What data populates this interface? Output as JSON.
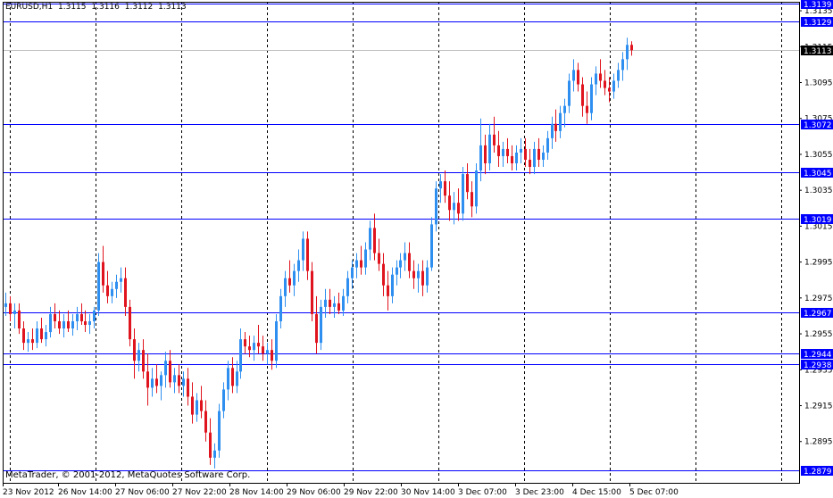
{
  "header": {
    "symbol": "EURUSD,H1",
    "open": "1.3115",
    "high": "1.3116",
    "low": "1.3112",
    "close": "1.3113"
  },
  "footer": {
    "copyright": "MetaTrader, © 2001-2012, MetaQuotes Software Corp."
  },
  "colors": {
    "background": "#ffffff",
    "frame": "#000000",
    "grid": "#000000",
    "bull": "#2e8ff0",
    "bear": "#e0141e",
    "level_line": "#0000ff",
    "level_label_bg": "#0000ff",
    "level_label_text": "#ffffff",
    "bid_line": "#c0c0c0",
    "bid_label_bg": "#000000",
    "bid_label_text": "#ffffff"
  },
  "chart_data": {
    "type": "candlestick",
    "timeframe": "H1",
    "ylim": [
      1.2872,
      1.314
    ],
    "y_ticks": [
      "1.3135",
      "1.3115",
      "1.3095",
      "1.3075",
      "1.3055",
      "1.3035",
      "1.3015",
      "1.2995",
      "1.2975",
      "1.2955",
      "1.2935",
      "1.2915",
      "1.2895"
    ],
    "x_ticks": [
      "23 Nov 2012",
      "26 Nov 14:00",
      "27 Nov 06:00",
      "27 Nov 22:00",
      "28 Nov 14:00",
      "29 Nov 06:00",
      "29 Nov 22:00",
      "30 Nov 14:00",
      "3 Dec 07:00",
      "3 Dec 23:00",
      "4 Dec 15:00",
      "5 Dec 07:00"
    ],
    "horizontal_levels": [
      "1.3139",
      "1.3129",
      "1.3072",
      "1.3045",
      "1.3019",
      "1.2967",
      "1.2944",
      "1.2938",
      "1.2879"
    ],
    "bid": "1.3113",
    "grid": "vertical dashed",
    "candles": [
      [
        1.297,
        1.2978,
        1.2965,
        1.2972
      ],
      [
        1.2972,
        1.2976,
        1.2962,
        1.2966
      ],
      [
        1.2966,
        1.2972,
        1.2958,
        1.2968
      ],
      [
        1.2968,
        1.2972,
        1.2955,
        1.2958
      ],
      [
        1.2958,
        1.2962,
        1.2946,
        1.295
      ],
      [
        1.295,
        1.2956,
        1.2945,
        1.2952
      ],
      [
        1.2952,
        1.2958,
        1.2946,
        1.295
      ],
      [
        1.295,
        1.2962,
        1.2947,
        1.2958
      ],
      [
        1.2958,
        1.2964,
        1.295,
        1.2952
      ],
      [
        1.2952,
        1.296,
        1.2948,
        1.2956
      ],
      [
        1.2956,
        1.297,
        1.2953,
        1.2966
      ],
      [
        1.2966,
        1.2972,
        1.2958,
        1.2962
      ],
      [
        1.2962,
        1.2968,
        1.2955,
        1.2958
      ],
      [
        1.2958,
        1.2966,
        1.2953,
        1.2962
      ],
      [
        1.2962,
        1.2968,
        1.2956,
        1.2958
      ],
      [
        1.2958,
        1.2966,
        1.2954,
        1.2962
      ],
      [
        1.2962,
        1.297,
        1.2957,
        1.2966
      ],
      [
        1.2966,
        1.2972,
        1.296,
        1.2962
      ],
      [
        1.2962,
        1.2968,
        1.2956,
        1.296
      ],
      [
        1.296,
        1.2966,
        1.2955,
        1.2962
      ],
      [
        1.2962,
        1.297,
        1.2958,
        1.2968
      ],
      [
        1.2968,
        1.3,
        1.2965,
        1.2995
      ],
      [
        1.2995,
        1.3004,
        1.2978,
        1.2982
      ],
      [
        1.2982,
        1.299,
        1.2972,
        1.2976
      ],
      [
        1.2976,
        1.2984,
        1.2972,
        1.298
      ],
      [
        1.298,
        1.2988,
        1.2975,
        1.2984
      ],
      [
        1.2984,
        1.2992,
        1.2978,
        1.2986
      ],
      [
        1.2986,
        1.2992,
        1.2965,
        1.297
      ],
      [
        1.297,
        1.2974,
        1.2948,
        1.2952
      ],
      [
        1.2952,
        1.2958,
        1.293,
        1.294
      ],
      [
        1.294,
        1.295,
        1.2934,
        1.2946
      ],
      [
        1.2946,
        1.2952,
        1.293,
        1.2934
      ],
      [
        1.2934,
        1.2944,
        1.2915,
        1.2925
      ],
      [
        1.2925,
        1.2936,
        1.292,
        1.293
      ],
      [
        1.293,
        1.2938,
        1.2922,
        1.2926
      ],
      [
        1.2926,
        1.2934,
        1.2918,
        1.2932
      ],
      [
        1.2932,
        1.2945,
        1.2925,
        1.294
      ],
      [
        1.294,
        1.2946,
        1.2925,
        1.2928
      ],
      [
        1.2928,
        1.2936,
        1.2922,
        1.2932
      ],
      [
        1.2932,
        1.2938,
        1.2922,
        1.2926
      ],
      [
        1.2926,
        1.2934,
        1.292,
        1.293
      ],
      [
        1.293,
        1.2936,
        1.2915,
        1.292
      ],
      [
        1.292,
        1.2928,
        1.2905,
        1.291
      ],
      [
        1.291,
        1.2922,
        1.2906,
        1.2918
      ],
      [
        1.2918,
        1.2926,
        1.2908,
        1.2912
      ],
      [
        1.2912,
        1.2918,
        1.2895,
        1.29
      ],
      [
        1.29,
        1.2908,
        1.2882,
        1.2886
      ],
      [
        1.2886,
        1.2894,
        1.288,
        1.289
      ],
      [
        1.289,
        1.2916,
        1.2886,
        1.2912
      ],
      [
        1.2912,
        1.2928,
        1.2908,
        1.2924
      ],
      [
        1.2924,
        1.294,
        1.2918,
        1.2936
      ],
      [
        1.2936,
        1.2942,
        1.2922,
        1.2926
      ],
      [
        1.2926,
        1.294,
        1.2922,
        1.2934
      ],
      [
        1.2934,
        1.2958,
        1.293,
        1.2952
      ],
      [
        1.2952,
        1.2956,
        1.2944,
        1.2948
      ],
      [
        1.2948,
        1.2954,
        1.2942,
        1.2946
      ],
      [
        1.2946,
        1.2954,
        1.294,
        1.295
      ],
      [
        1.295,
        1.296,
        1.2944,
        1.2948
      ],
      [
        1.2948,
        1.2954,
        1.294,
        1.2944
      ],
      [
        1.2944,
        1.295,
        1.2938,
        1.2946
      ],
      [
        1.2946,
        1.2952,
        1.2935,
        1.294
      ],
      [
        1.294,
        1.2966,
        1.2936,
        1.2962
      ],
      [
        1.2962,
        1.298,
        1.2958,
        1.2976
      ],
      [
        1.2976,
        1.299,
        1.297,
        1.2986
      ],
      [
        1.2986,
        1.2996,
        1.2978,
        1.2982
      ],
      [
        1.2982,
        1.2994,
        1.2976,
        1.299
      ],
      [
        1.299,
        1.3002,
        1.2984,
        1.2996
      ],
      [
        1.2996,
        1.3012,
        1.299,
        1.3008
      ],
      [
        1.3008,
        1.3012,
        1.2985,
        1.299
      ],
      [
        1.299,
        1.2995,
        1.2962,
        1.2966
      ],
      [
        1.2966,
        1.2976,
        1.2944,
        1.295
      ],
      [
        1.295,
        1.2974,
        1.2946,
        1.297
      ],
      [
        1.297,
        1.298,
        1.2964,
        1.2974
      ],
      [
        1.2974,
        1.298,
        1.2966,
        1.297
      ],
      [
        1.297,
        1.2976,
        1.2964,
        1.2972
      ],
      [
        1.2972,
        1.2978,
        1.2966,
        1.2968
      ],
      [
        1.2968,
        1.298,
        1.2965,
        1.2976
      ],
      [
        1.2976,
        1.299,
        1.2972,
        1.2986
      ],
      [
        1.2986,
        1.2996,
        1.298,
        1.2992
      ],
      [
        1.2992,
        1.3,
        1.2986,
        1.2996
      ],
      [
        1.2996,
        1.3004,
        1.2988,
        1.2992
      ],
      [
        1.2992,
        1.3006,
        1.2988,
        1.3002
      ],
      [
        1.3002,
        1.3018,
        1.2996,
        1.3014
      ],
      [
        1.3014,
        1.3022,
        1.2996,
        1.3
      ],
      [
        1.3,
        1.3008,
        1.299,
        1.2994
      ],
      [
        1.2994,
        1.3,
        1.2976,
        1.2982
      ],
      [
        1.2982,
        1.299,
        1.2968,
        1.2976
      ],
      [
        1.2976,
        1.2992,
        1.2972,
        1.2988
      ],
      [
        1.2988,
        1.2996,
        1.2982,
        1.2992
      ],
      [
        1.2992,
        1.3,
        1.2986,
        1.2996
      ],
      [
        1.2996,
        1.3006,
        1.299,
        1.3
      ],
      [
        1.3,
        1.3006,
        1.2986,
        1.299
      ],
      [
        1.299,
        1.2996,
        1.298,
        1.2986
      ],
      [
        1.2986,
        1.2994,
        1.2978,
        1.299
      ],
      [
        1.299,
        1.2996,
        1.2976,
        1.2982
      ],
      [
        1.2982,
        1.2996,
        1.2978,
        1.2992
      ],
      [
        1.2992,
        1.302,
        1.299,
        1.3016
      ],
      [
        1.3016,
        1.304,
        1.3012,
        1.3036
      ],
      [
        1.3036,
        1.3044,
        1.3028,
        1.304
      ],
      [
        1.304,
        1.3046,
        1.3028,
        1.3032
      ],
      [
        1.3032,
        1.304,
        1.3018,
        1.3024
      ],
      [
        1.3024,
        1.3034,
        1.3016,
        1.3028
      ],
      [
        1.3028,
        1.3036,
        1.3018,
        1.3022
      ],
      [
        1.3022,
        1.3048,
        1.3018,
        1.3044
      ],
      [
        1.3044,
        1.305,
        1.303,
        1.3034
      ],
      [
        1.3034,
        1.304,
        1.302,
        1.3026
      ],
      [
        1.3026,
        1.305,
        1.3022,
        1.3046
      ],
      [
        1.3046,
        1.3075,
        1.304,
        1.306
      ],
      [
        1.306,
        1.3066,
        1.3044,
        1.305
      ],
      [
        1.305,
        1.3072,
        1.3046,
        1.3066
      ],
      [
        1.3066,
        1.3076,
        1.3056,
        1.306
      ],
      [
        1.306,
        1.3068,
        1.3048,
        1.3054
      ],
      [
        1.3054,
        1.3062,
        1.3048,
        1.3058
      ],
      [
        1.3058,
        1.3064,
        1.305,
        1.3054
      ],
      [
        1.3054,
        1.306,
        1.3046,
        1.305
      ],
      [
        1.305,
        1.306,
        1.3046,
        1.3056
      ],
      [
        1.3056,
        1.3064,
        1.305,
        1.3058
      ],
      [
        1.3058,
        1.3064,
        1.3048,
        1.3052
      ],
      [
        1.3052,
        1.3058,
        1.3044,
        1.3048
      ],
      [
        1.3048,
        1.3062,
        1.3044,
        1.3058
      ],
      [
        1.3058,
        1.3064,
        1.3048,
        1.3052
      ],
      [
        1.3052,
        1.306,
        1.3048,
        1.3056
      ],
      [
        1.3056,
        1.3068,
        1.3052,
        1.3064
      ],
      [
        1.3064,
        1.3076,
        1.3058,
        1.3072
      ],
      [
        1.3072,
        1.308,
        1.3062,
        1.3068
      ],
      [
        1.3068,
        1.3082,
        1.3064,
        1.3078
      ],
      [
        1.3078,
        1.3086,
        1.307,
        1.3082
      ],
      [
        1.3082,
        1.31,
        1.3078,
        1.3096
      ],
      [
        1.3096,
        1.3108,
        1.309,
        1.3102
      ],
      [
        1.3102,
        1.3106,
        1.309,
        1.3094
      ],
      [
        1.3094,
        1.3098,
        1.3076,
        1.3082
      ],
      [
        1.3082,
        1.309,
        1.3072,
        1.3078
      ],
      [
        1.3078,
        1.3098,
        1.3074,
        1.3094
      ],
      [
        1.3094,
        1.3104,
        1.3088,
        1.31
      ],
      [
        1.31,
        1.3108,
        1.3092,
        1.3096
      ],
      [
        1.3096,
        1.3102,
        1.3088,
        1.3092
      ],
      [
        1.3092,
        1.3098,
        1.3084,
        1.309
      ],
      [
        1.309,
        1.31,
        1.3086,
        1.3096
      ],
      [
        1.3096,
        1.3106,
        1.3092,
        1.3102
      ],
      [
        1.3102,
        1.3112,
        1.3096,
        1.3108
      ],
      [
        1.3108,
        1.312,
        1.3102,
        1.3116
      ],
      [
        1.3116,
        1.3118,
        1.311,
        1.3113
      ]
    ]
  }
}
